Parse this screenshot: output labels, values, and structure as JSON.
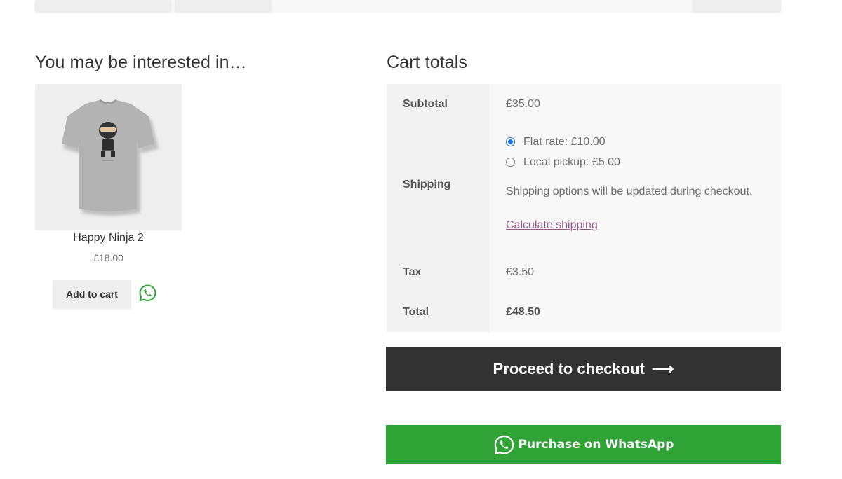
{
  "related": {
    "heading": "You may be interested in…",
    "product": {
      "name": "Happy Ninja 2",
      "price": "£18.00",
      "add_to_cart_label": "Add to cart"
    }
  },
  "cart_totals": {
    "heading": "Cart totals",
    "subtotal_label": "Subtotal",
    "subtotal_value": "£35.00",
    "shipping_label": "Shipping",
    "shipping_options": [
      {
        "label": "Flat rate: £10.00",
        "selected": true
      },
      {
        "label": "Local pickup: £5.00",
        "selected": false
      }
    ],
    "shipping_note": "Shipping options will be updated during checkout.",
    "calculate_shipping_label": "Calculate shipping",
    "tax_label": "Tax",
    "tax_value": "£3.50",
    "total_label": "Total",
    "total_value": "£48.50"
  },
  "actions": {
    "checkout_label": "Proceed to checkout",
    "checkout_icon": "arrow-right-icon",
    "whatsapp_label": "Purchase on WhatsApp",
    "whatsapp_icon": "whatsapp-icon"
  },
  "colors": {
    "checkout_bg": "#333333",
    "whatsapp_bg": "#2fa336",
    "link": "#96588a",
    "radio_accent": "#1a73e8"
  }
}
